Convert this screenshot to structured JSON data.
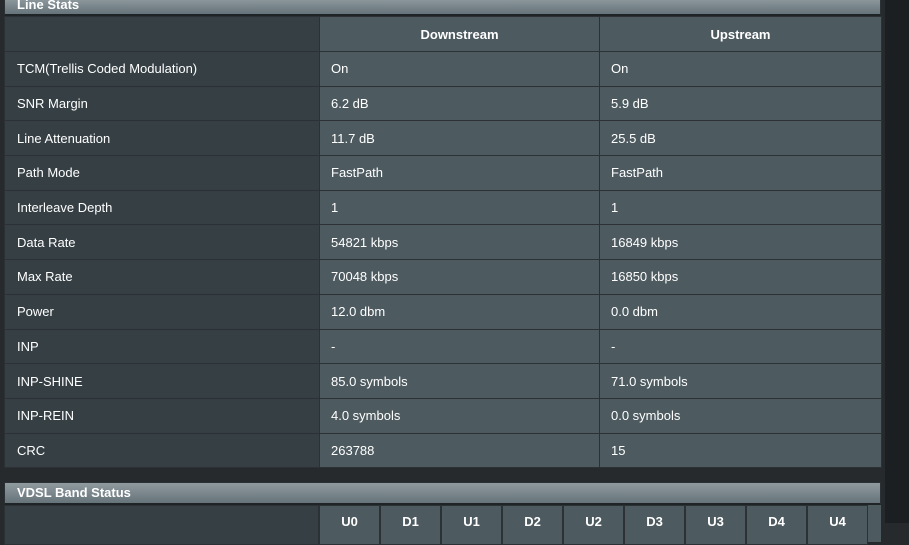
{
  "line_stats": {
    "title": "Line Stats",
    "columns": [
      "Downstream",
      "Upstream"
    ],
    "rows": [
      {
        "label": "TCM(Trellis Coded Modulation)",
        "down": "On",
        "up": "On"
      },
      {
        "label": "SNR Margin",
        "down": "6.2 dB",
        "up": "5.9 dB"
      },
      {
        "label": "Line Attenuation",
        "down": "11.7 dB",
        "up": "25.5 dB"
      },
      {
        "label": "Path Mode",
        "down": "FastPath",
        "up": "FastPath"
      },
      {
        "label": "Interleave Depth",
        "down": "1",
        "up": "1"
      },
      {
        "label": "Data Rate",
        "down": "54821 kbps",
        "up": "16849 kbps"
      },
      {
        "label": "Max Rate",
        "down": "70048 kbps",
        "up": "16850 kbps"
      },
      {
        "label": "Power",
        "down": "12.0 dbm",
        "up": "0.0 dbm"
      },
      {
        "label": "INP",
        "down": "-",
        "up": "-"
      },
      {
        "label": "INP-SHINE",
        "down": "85.0 symbols",
        "up": "71.0 symbols"
      },
      {
        "label": "INP-REIN",
        "down": "4.0 symbols",
        "up": "0.0 symbols"
      },
      {
        "label": "CRC",
        "down": "263788",
        "up": "15"
      }
    ]
  },
  "vdsl_band": {
    "title": "VDSL Band Status",
    "bands": [
      "U0",
      "D1",
      "U1",
      "D2",
      "U2",
      "D3",
      "U3",
      "D4",
      "U4"
    ]
  }
}
